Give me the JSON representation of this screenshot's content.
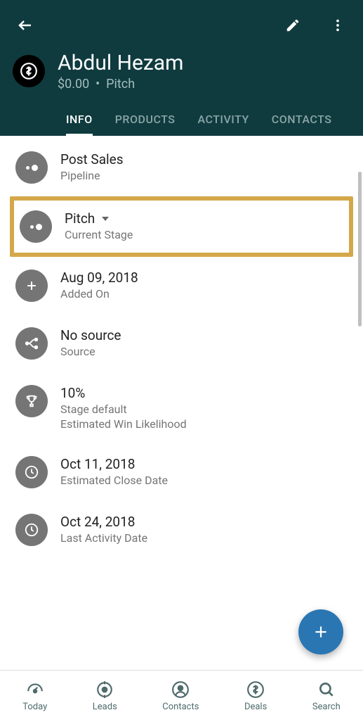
{
  "header": {
    "title": "Abdul Hezam",
    "amount": "$0.00",
    "sep": "•",
    "stage": "Pitch"
  },
  "tabs": [
    {
      "label": "INFO",
      "active": true
    },
    {
      "label": "PRODUCTS",
      "active": false
    },
    {
      "label": "ACTIVITY",
      "active": false
    },
    {
      "label": "CONTACTS",
      "active": false
    }
  ],
  "rows": {
    "pipeline": {
      "value": "Post Sales",
      "label": "Pipeline"
    },
    "stage": {
      "value": "Pitch",
      "label": "Current Stage"
    },
    "added": {
      "value": "Aug 09, 2018",
      "label": "Added On"
    },
    "source": {
      "value": "No source",
      "label": "Source"
    },
    "win": {
      "value": "10%",
      "label": "Stage default",
      "extra": "Estimated Win Likelihood"
    },
    "close": {
      "value": "Oct 11, 2018",
      "label": "Estimated Close Date"
    },
    "activity": {
      "value": "Oct 24, 2018",
      "label": "Last Activity Date"
    }
  },
  "nav": [
    {
      "label": "Today"
    },
    {
      "label": "Leads"
    },
    {
      "label": "Contacts"
    },
    {
      "label": "Deals"
    },
    {
      "label": "Search"
    }
  ]
}
